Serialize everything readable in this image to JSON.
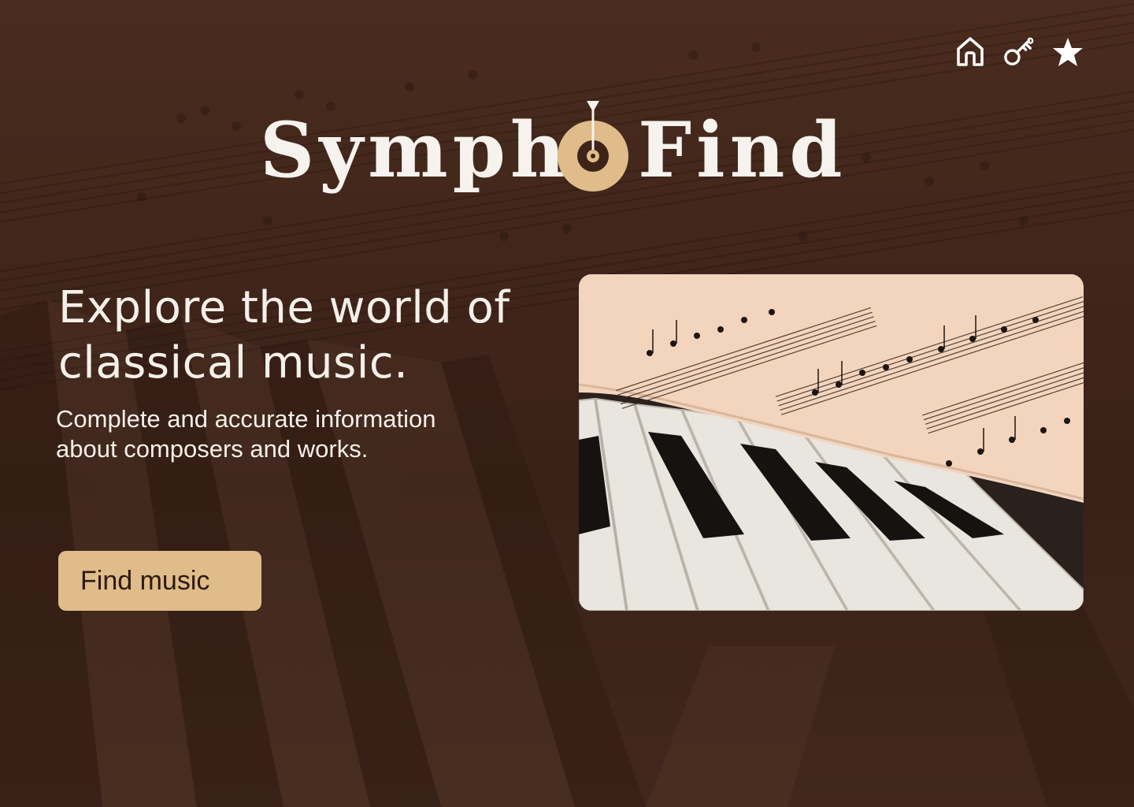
{
  "brand": {
    "name_left": "Symph",
    "name_right": "Find",
    "accent_color": "#dfbc89",
    "background_color": "#3e2418"
  },
  "nav": {
    "items": [
      {
        "icon": "home-icon"
      },
      {
        "icon": "key-icon"
      },
      {
        "icon": "star-icon"
      }
    ]
  },
  "hero": {
    "headline": "Explore the world of classical music.",
    "subtext": "Complete and accurate information about composers and works.",
    "cta_label": "Find music",
    "image": "sheet-music-on-piano-keys"
  }
}
